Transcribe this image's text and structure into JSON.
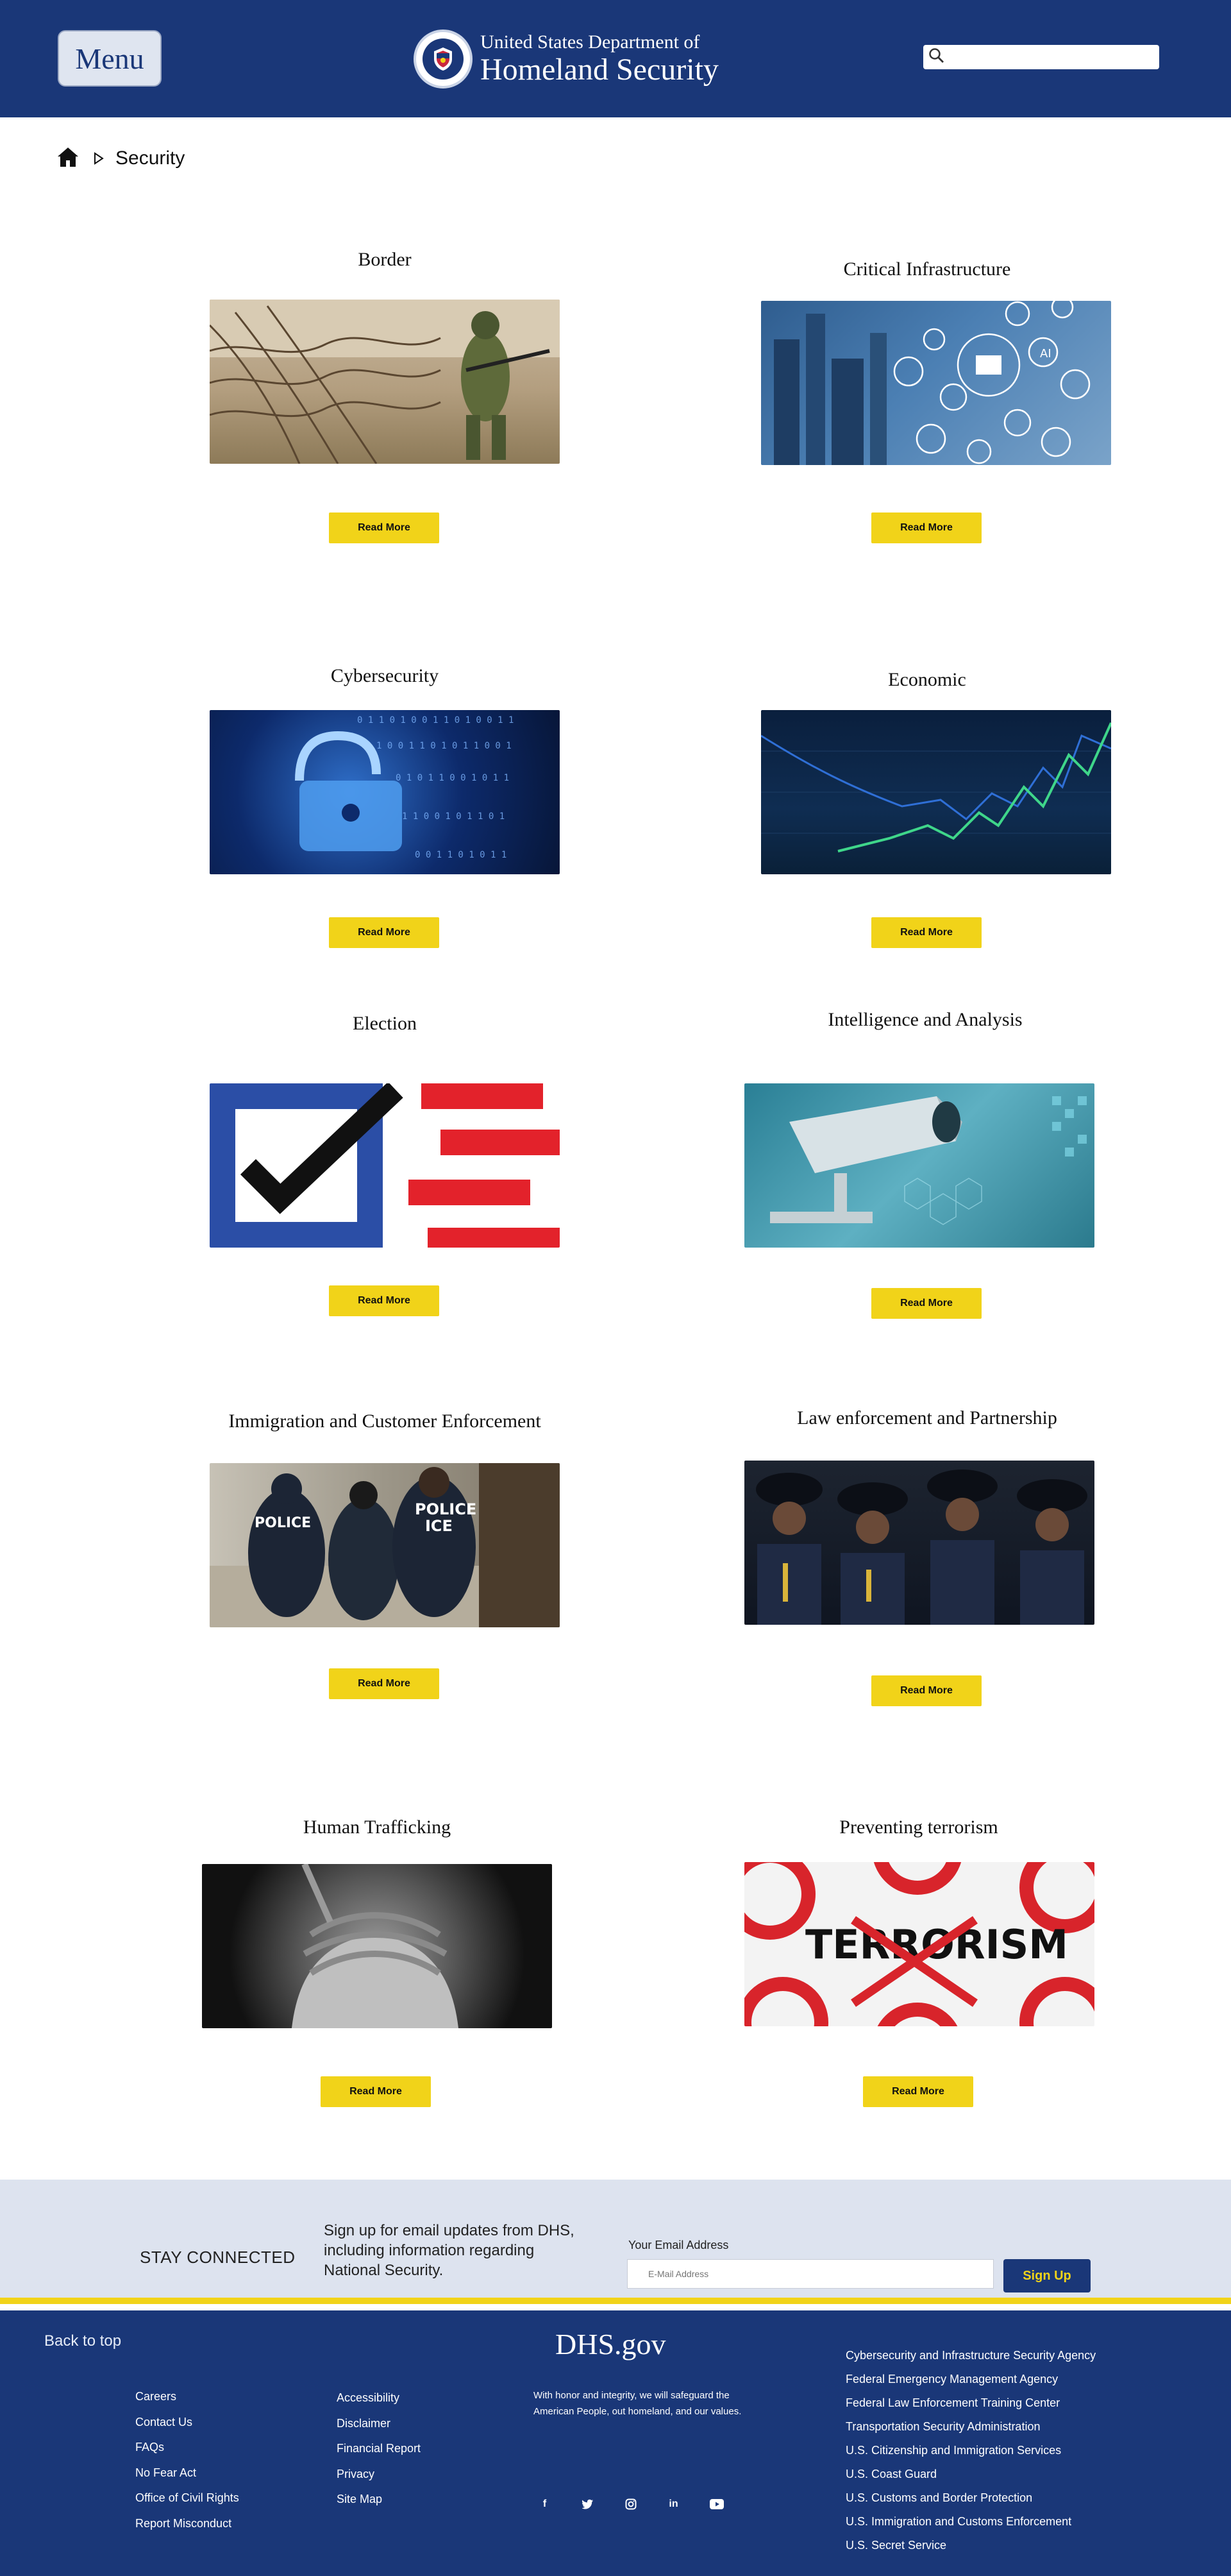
{
  "header": {
    "menu_label": "Menu",
    "logo_line1": "United States Department of",
    "logo_line2": "Homeland Security",
    "search_placeholder": ""
  },
  "breadcrumb": {
    "current": "Security"
  },
  "read_more_label": "Read More",
  "cards": [
    {
      "title": "Border",
      "image": "barbed-wire-soldier"
    },
    {
      "title": "Critical Infrastructure",
      "image": "industrial-plant-icons"
    },
    {
      "title": "Cybersecurity",
      "image": "digital-padlock"
    },
    {
      "title": "Economic",
      "image": "financial-graph"
    },
    {
      "title": "Election",
      "image": "ballot-checkbox"
    },
    {
      "title": "Intelligence and Analysis",
      "image": "security-camera"
    },
    {
      "title": "Immigration and Customer Enforcement",
      "image": "ice-officers"
    },
    {
      "title": "Law enforcement and Partnership",
      "image": "police-officers"
    },
    {
      "title": "Human Trafficking",
      "image": "bound-hands"
    },
    {
      "title": "Preventing terrorism",
      "image": "terrorism-sign"
    }
  ],
  "stay_connected": {
    "title": "STAY CONNECTED",
    "description": "Sign up for email updates from DHS, including information regarding National Security.",
    "email_label": "Your Email Address",
    "email_placeholder": "E-Mail Address",
    "signup_label": "Sign Up"
  },
  "footer": {
    "back_to_top": "Back to top",
    "site_title": "DHS.gov",
    "tagline": "With honor and integrity, we will safeguard the American People, out homeland, and our values.",
    "col1": [
      "Careers",
      "Contact Us",
      "FAQs",
      "No Fear Act",
      "Office of Civil Rights",
      "Report Misconduct"
    ],
    "col2": [
      "Accessibility",
      "Disclaimer",
      "Financial Report",
      "Privacy",
      "Site Map"
    ],
    "agencies": [
      "Cybersecurity and Infrastructure Security Agency",
      "Federal Emergency Management Agency",
      "Federal Law Enforcement Training Center",
      "Transportation Security Administration",
      "U.S. Citizenship and Immigration Services",
      "U.S. Coast Guard",
      "U.S. Customs and Border Protection",
      "U.S. Immigration and Customs Enforcement",
      "U.S. Secret Service"
    ],
    "socials": [
      {
        "icon": "facebook-icon",
        "glyph": "f"
      },
      {
        "icon": "twitter-icon",
        "glyph": "t"
      },
      {
        "icon": "instagram-icon",
        "glyph": "◻"
      },
      {
        "icon": "linkedin-icon",
        "glyph": "in"
      },
      {
        "icon": "youtube-icon",
        "glyph": "▶"
      }
    ]
  },
  "colors": {
    "brand_navy": "#1a3778",
    "accent_yellow": "#f1d319",
    "stay_bg": "#dde3ef"
  }
}
